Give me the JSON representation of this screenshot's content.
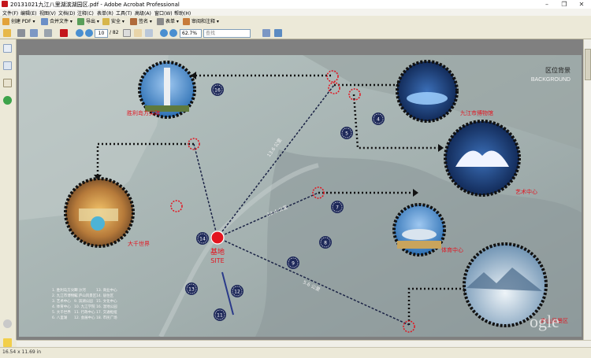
{
  "window": {
    "title": "20131021九江八里湖滨湖园区.pdf - Adobe Acrobat Professional",
    "controls": [
      "minimize",
      "restore",
      "close"
    ]
  },
  "menu": [
    "文件(F)",
    "编辑(E)",
    "视图(V)",
    "文档(D)",
    "注释(C)",
    "表单(R)",
    "工具(T)",
    "高级(A)",
    "窗口(W)",
    "帮助(H)"
  ],
  "toolbar": {
    "create_pdf": "创建 PDF",
    "combine": "合并文件",
    "export": "导出",
    "secure": "安全",
    "sign": "签名",
    "forms": "表单",
    "review": "审阅和注释"
  },
  "nav": {
    "page_current": "10",
    "page_total": "/ 82",
    "zoom": "62.7%",
    "find_placeholder": "查找"
  },
  "map": {
    "header": "区位背景",
    "header_sub": "BACKGROUND",
    "site_label": "基地",
    "site_sub": "SITE",
    "watermark": "ogle",
    "places": {
      "obelisk": "胜利岛方尖碑",
      "museum": "九江市博物馆",
      "art_center": "艺术中心",
      "sports": "体育中心",
      "park": "大千世界",
      "lushan": "庐山风景区"
    },
    "route_labels": [
      "13.6 公里",
      "13.4 公里",
      "5.6 公里"
    ],
    "markers": [
      "16",
      "4",
      "5",
      "7",
      "8",
      "9",
      "14",
      "13",
      "12",
      "11"
    ],
    "legend": [
      "1. 胜利岛方尖碑",
      "2. 九江市博物馆",
      "3. 艺术中心",
      "4. 体育中心",
      "5. 大千世界",
      "6. 八里湖",
      "7. 沙河",
      "8. 庐山风景区",
      "9. 滨湖公园",
      "10. 九江学院",
      "11. 行政中心",
      "12. 会展中心",
      "13. 商业中心",
      "14. 居住区",
      "15. 文化中心",
      "16. 湿地公园",
      "17. 交通枢纽",
      "18. 市民广场"
    ]
  },
  "status": {
    "page_size": "16.54 x 11.69 in"
  },
  "colors": {
    "accent_red": "#e3141f",
    "navy": "#1f2a5a",
    "background": "#ece9d8"
  }
}
